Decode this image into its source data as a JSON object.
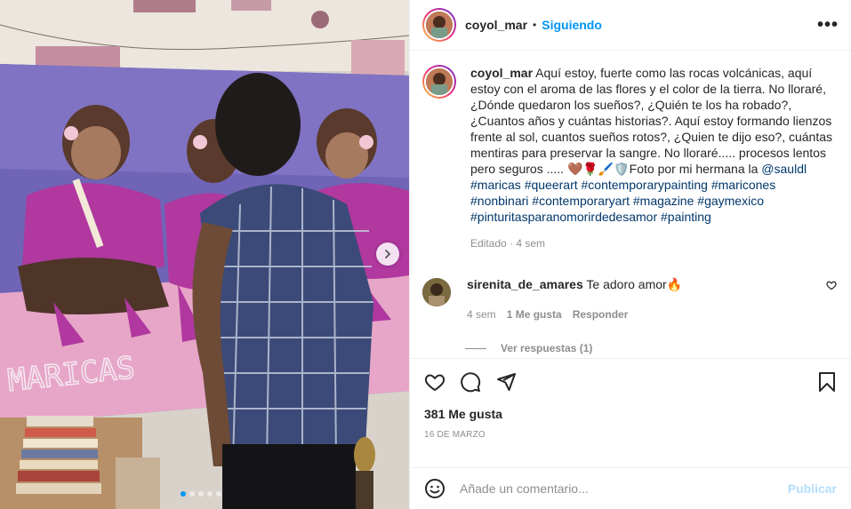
{
  "post": {
    "username": "coyol_mar",
    "separator": "•",
    "follow_status": "Siguiendo",
    "more_label": "•••"
  },
  "caption": {
    "username": "coyol_mar",
    "text": "Aquí estoy, fuerte como las rocas volcánicas, aquí estoy con el aroma de las flores y el color de la tierra. No lloraré, ¿Dónde quedaron los sueños?, ¿Quién te los ha robado?, ¿Cuantos años y cuántas historias?. Aquí estoy formando lienzos frente al sol, cuantos sueños rotos?, ¿Quien te dijo eso?, cuántas mentiras para preservar la sangre. No lloraré..... procesos lentos pero seguros ..... 🤎🌹🖌️🛡️Foto por mi hermana la",
    "mention": "@sauldl",
    "hashtags": [
      "#maricas",
      "#queerart",
      "#contemporarypainting",
      "#maricones",
      "#nonbinari",
      "#contemporaryart",
      "#magazine",
      "#gaymexico",
      "#pinturitasparanomorirdedesamor",
      "#painting"
    ],
    "edited": "Editado · 4 sem"
  },
  "comment": {
    "username": "sirenita_de_amares",
    "text": "Te adoro amor🔥",
    "age": "4 sem",
    "likes": "1 Me gusta",
    "reply": "Responder",
    "view_replies": "Ver respuestas (1)"
  },
  "footer": {
    "likes": "381 Me gusta",
    "date": "16 DE MARZO",
    "comment_placeholder": "Añade un comentario...",
    "publish": "Publicar"
  },
  "carousel": {
    "count": 5,
    "active": 0
  },
  "colors": {
    "accent": "#0095f6",
    "link": "#00376b",
    "muted": "#8e8e8e",
    "publish_disabled": "#b2dffc"
  },
  "painting_text": "MARICAS"
}
